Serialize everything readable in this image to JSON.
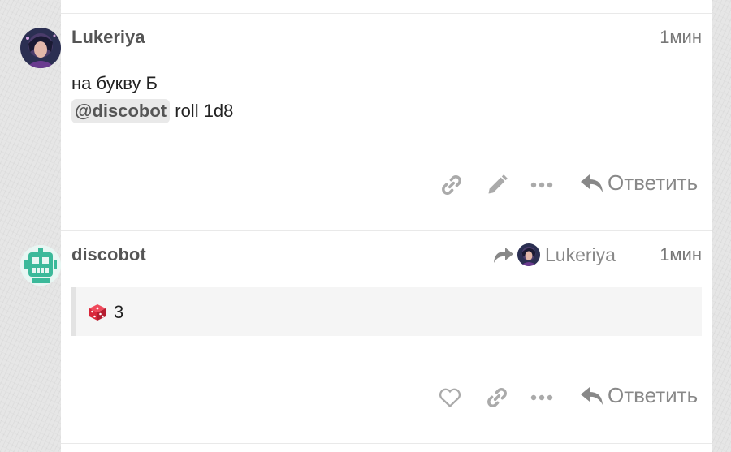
{
  "post1": {
    "username": "Lukeriya",
    "time": "1мин",
    "lines": [
      "на букву Б"
    ],
    "mention": "@discobot",
    "command": "roll 1d8",
    "actions": {
      "link_icon": "link-icon",
      "edit_icon": "pencil-icon",
      "more_icon": "ellipsis-icon",
      "reply_label": "Ответить"
    }
  },
  "post2": {
    "username": "discobot",
    "time": "1мин",
    "reply_to_user": "Lukeriya",
    "result": "3",
    "actions": {
      "like_icon": "heart-icon",
      "link_icon": "link-icon",
      "more_icon": "ellipsis-icon",
      "reply_label": "Ответить"
    }
  },
  "colors": {
    "bot_avatar_bg": "#e8f6f3",
    "bot_avatar": "#3bb99a",
    "dice": "#d9263a",
    "icon": "#aaaaaa"
  }
}
